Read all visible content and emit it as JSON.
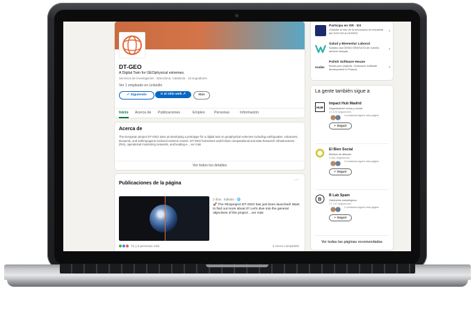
{
  "company": {
    "name": "DT-GEO",
    "tagline": "A Digital Twin for GEOphysical extremes.",
    "meta": "Servicios de investigación · Barcelona, Catalonia · 13 seguidores",
    "employees": "Ver 1 empleado en LinkedIn",
    "buttons": {
      "following": "✓ Siguiendo",
      "website": "Ir al sitio web ↗",
      "more": "Más"
    },
    "tabs": [
      "Inicio",
      "Acerca de",
      "Publicaciones",
      "Empleo",
      "Personas",
      "Información"
    ]
  },
  "about": {
    "heading": "Acerca de",
    "text": "The European project DT-GEO aims at developing a prototype for a digital twin on geophysical extremes including earthquakes, volcanoes, tsunamis, and anthropogenic-induced extreme events. DT-GEO harnesses world-class computational and data Research Infrastructures (RIs), operational monitoring networks, and leading-e... ver más",
    "see_all": "Ver todos los detalles"
  },
  "posts": {
    "heading": "Publicaciones de la página",
    "more": "···",
    "meta": "2 días · Editado · 🌐",
    "text": "🚀 The #EUproject DT-GEO has just been launched! Want to find out more about it? Let's dive into the general objectives of the project ...ver más",
    "reactions": "Tú y 6 personas más",
    "shares": "3 veces compartido"
  },
  "ads": [
    {
      "title": "Participa en OR · EX",
      "desc": "¡Súmate al reto de la innovación en industrial del 20/11/23 al 01/03/22",
      "icon_color": "#1b2a6b"
    },
    {
      "title": "Salud y Bienestar Laboral",
      "desc": "Solicita una DEMO GRATUITA de nuestro servicio integral",
      "icon_color": "#2bb3a6"
    },
    {
      "title": "Polish Software House",
      "desc": "Boost your projects. Outsource software development to Poland.",
      "icon_color": "#ffffff"
    }
  ],
  "suggestions": {
    "title": "La gente también sigue a",
    "items": [
      {
        "name": "Impact Hub Madrid",
        "category": "Organización cívica y social",
        "followers": "17.220 seguidores",
        "mutual": "4 contactos siguen esta página",
        "follow": "+ Seguir"
      },
      {
        "name": "El Bien Social",
        "category": "Medios de difusión",
        "followers": "4.481 seguidores",
        "mutual": "2 contactos siguen esta página",
        "follow": "+ Seguir"
      },
      {
        "name": "B Lab Spain",
        "category": "Gabinetes estratégicos",
        "followers": "17.747 seguidores",
        "mutual": "2 contactos siguen esta página",
        "follow": "+ Seguir"
      }
    ],
    "see_all": "Ver todas las páginas recomendadas"
  }
}
